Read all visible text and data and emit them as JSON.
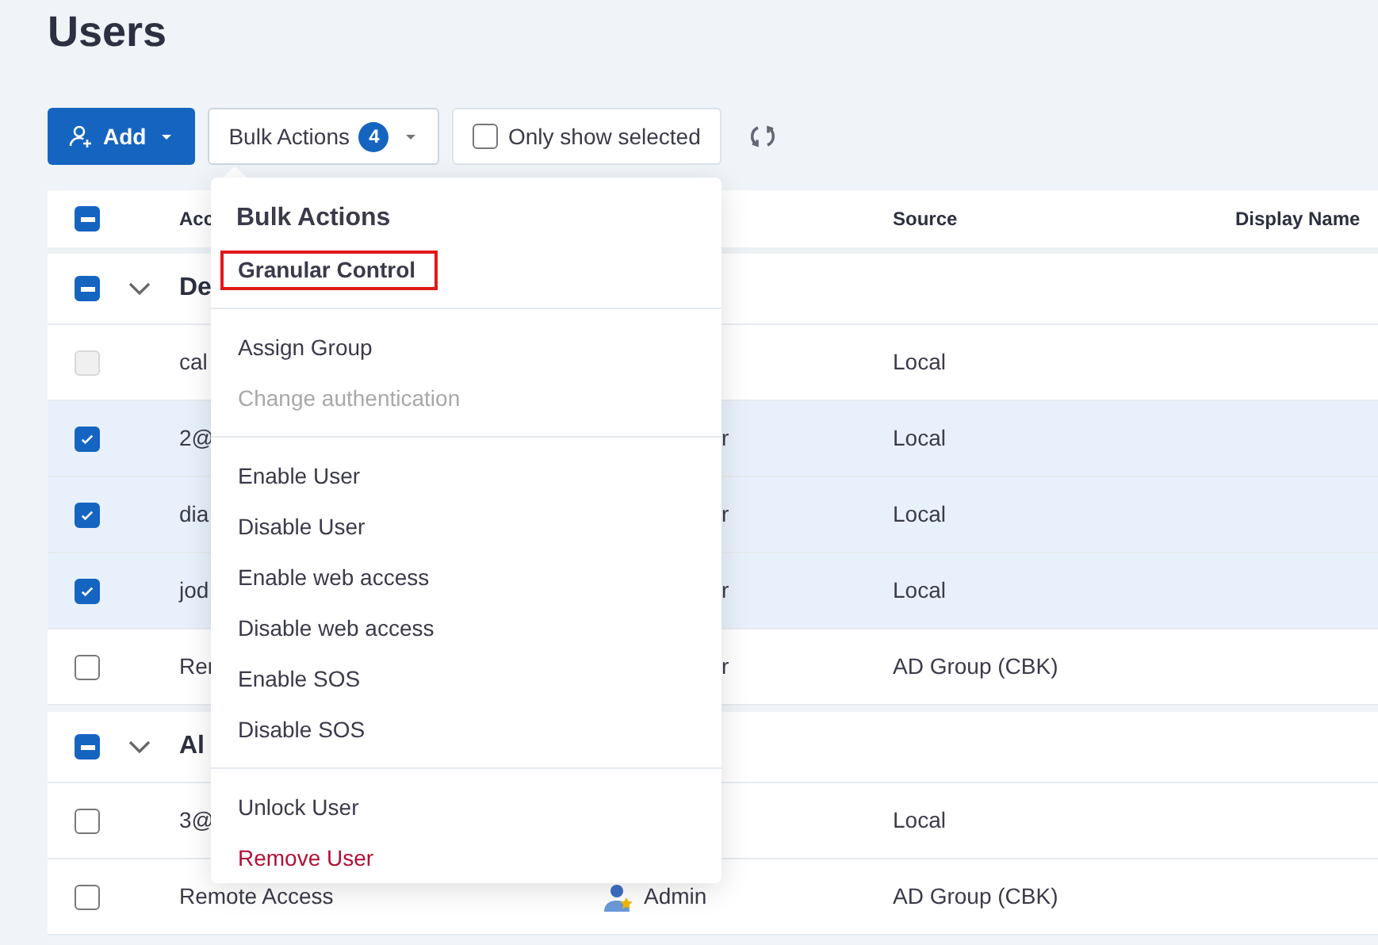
{
  "page": {
    "title": "Users"
  },
  "toolbar": {
    "add_button": "Add",
    "bulk_button": {
      "label": "Bulk Actions",
      "count": "4",
      "expanded": true
    },
    "only_selected": {
      "label": "Only show selected",
      "checked": false
    }
  },
  "table": {
    "header": {
      "indeterminate": true,
      "columns": [
        "Acc",
        "Source",
        "Display Name"
      ]
    },
    "groups": [
      {
        "name": "De",
        "indeterminate": true,
        "expanded": true,
        "rows": [
          {
            "kind": "plain",
            "account": "cal",
            "source": "Local",
            "checked": false,
            "disabled": true,
            "selected": false
          },
          {
            "kind": "plain",
            "account": "2@",
            "role": "r",
            "source": "Local",
            "checked": true,
            "disabled": false,
            "selected": true
          },
          {
            "kind": "plain",
            "account": "dia",
            "role": "r",
            "source": "Local",
            "checked": true,
            "disabled": false,
            "selected": true
          },
          {
            "kind": "plain",
            "account": "jod",
            "role": "r",
            "source": "Local",
            "checked": true,
            "disabled": false,
            "selected": true
          },
          {
            "kind": "plain",
            "account": "Rer",
            "role": "r",
            "source": "AD Group (CBK)",
            "checked": false,
            "disabled": false,
            "selected": false
          }
        ]
      },
      {
        "name": "Al",
        "indeterminate": true,
        "expanded": true,
        "rows": [
          {
            "kind": "plain",
            "account": "3@",
            "source": "Local",
            "checked": false,
            "disabled": false,
            "selected": false
          },
          {
            "kind": "admin",
            "account": "Remote Access",
            "role": "Admin",
            "source": "AD Group (CBK)",
            "checked": false,
            "disabled": false,
            "selected": false
          }
        ]
      }
    ]
  },
  "menu": {
    "title": "Bulk Actions",
    "sections": [
      [
        {
          "label": "Granular Control",
          "outlined": true,
          "disabled": false,
          "kind": "normal"
        }
      ],
      [
        {
          "label": "Assign Group",
          "outlined": false,
          "disabled": false,
          "kind": "normal"
        },
        {
          "label": "Change authentication",
          "outlined": false,
          "disabled": true,
          "kind": "normal"
        }
      ],
      [
        {
          "label": "Enable User",
          "outlined": false,
          "disabled": false,
          "kind": "normal"
        },
        {
          "label": "Disable User",
          "outlined": false,
          "disabled": false,
          "kind": "normal"
        },
        {
          "label": "Enable web access",
          "outlined": false,
          "disabled": false,
          "kind": "normal"
        },
        {
          "label": "Disable web access",
          "outlined": false,
          "disabled": false,
          "kind": "normal"
        },
        {
          "label": "Enable SOS",
          "outlined": false,
          "disabled": false,
          "kind": "normal"
        },
        {
          "label": "Disable SOS",
          "outlined": false,
          "disabled": false,
          "kind": "normal"
        }
      ],
      [
        {
          "label": "Unlock User",
          "outlined": false,
          "disabled": false,
          "kind": "normal"
        },
        {
          "label": "Remove User",
          "outlined": false,
          "disabled": false,
          "kind": "danger"
        }
      ]
    ]
  }
}
